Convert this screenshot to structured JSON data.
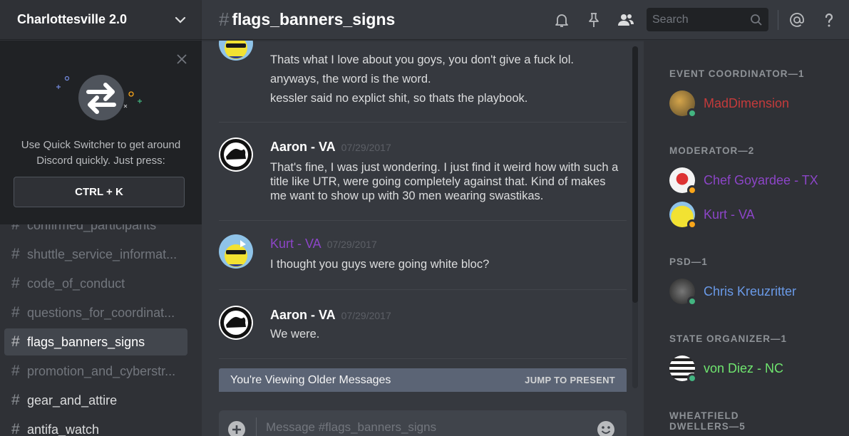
{
  "guild": {
    "name": "Charlottesville 2.0"
  },
  "quick_switcher": {
    "text": "Use Quick Switcher to get around Discord quickly. Just press:",
    "shortcut": "CTRL + K"
  },
  "channels": [
    {
      "name": "confirmed_participants",
      "style": "dim"
    },
    {
      "name": "shuttle_service_informat...",
      "style": "dim"
    },
    {
      "name": "code_of_conduct",
      "style": "dim"
    },
    {
      "name": "questions_for_coordinat...",
      "style": "dim"
    },
    {
      "name": "flags_banners_signs",
      "style": "active"
    },
    {
      "name": "promotion_and_cyberstr...",
      "style": "dim"
    },
    {
      "name": "gear_and_attire",
      "style": "bright"
    },
    {
      "name": "antifa_watch",
      "style": "bright"
    }
  ],
  "header": {
    "hash": "#",
    "channel": "flags_banners_signs",
    "search_placeholder": "Search",
    "icons": [
      "bell-icon",
      "pin-icon",
      "members-icon",
      "search-icon",
      "at-icon",
      "help-icon"
    ]
  },
  "messages": {
    "top_group": {
      "lines": [
        "Thats what I love about you goys, you don't give a fuck lol.",
        "anyways, the word is the word.",
        "kessler said no explict shit, so thats the playbook."
      ]
    },
    "groups": [
      {
        "author": "Aaron - VA",
        "timestamp": "07/29/2017",
        "text": "That's fine, I was just wondering. I just find it weird how with such a title like UTR, were going completely against that. Kind of makes me want to show up with 30 men wearing swastikas."
      },
      {
        "author": "Kurt - VA",
        "timestamp": "07/29/2017",
        "text": "I thought you guys were going white bloc?"
      },
      {
        "author": "Aaron - VA",
        "timestamp": "07/29/2017",
        "text": "We were."
      }
    ],
    "older_bar": {
      "text": "You're Viewing Older Messages",
      "jump": "JUMP TO PRESENT"
    }
  },
  "composer": {
    "placeholder": "Message #flags_banners_signs"
  },
  "members": {
    "roles": [
      {
        "title": "EVENT COORDINATOR—1",
        "members": [
          {
            "name": "MadDimension",
            "color": "#c43b3b",
            "status": "#43b581"
          }
        ]
      },
      {
        "title": "MODERATOR—2",
        "members": [
          {
            "name": "Chef Goyardee - TX",
            "color": "#8c45c7",
            "status": "#faa61a"
          },
          {
            "name": "Kurt - VA",
            "color": "#8c45c7",
            "status": "#faa61a"
          }
        ]
      },
      {
        "title": "PSD—1",
        "members": [
          {
            "name": "Chris Kreuzritter",
            "color": "#6a9ae8",
            "status": "#43b581"
          }
        ]
      },
      {
        "title": "STATE ORGANIZER—1",
        "members": [
          {
            "name": "von Diez - NC",
            "color": "#6fe56f",
            "status": "#43b581"
          }
        ]
      },
      {
        "title": "WHEATFIELD DWELLERS—5",
        "members": []
      }
    ]
  },
  "colors": {
    "background": "#36393f",
    "sidebar": "#2f3136",
    "accent_purple": "#8c45c7",
    "older_bar": "#5d6778"
  }
}
